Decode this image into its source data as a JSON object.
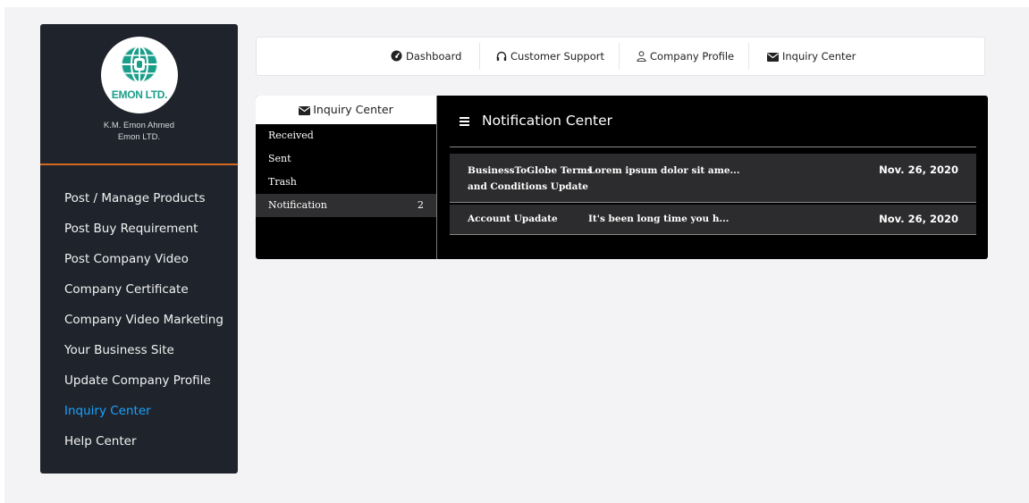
{
  "sidebar": {
    "logo_text": "EMON LTD.",
    "user_name": "K.M. Emon Ahmed",
    "company": "Emon LTD.",
    "accent_color": "#d2691e",
    "items": [
      {
        "label": "Post / Manage Products"
      },
      {
        "label": "Post Buy Requirement"
      },
      {
        "label": "Post Company Video"
      },
      {
        "label": "Company Certificate"
      },
      {
        "label": "Company Video Marketing"
      },
      {
        "label": "Your Business Site"
      },
      {
        "label": "Update Company Profile"
      },
      {
        "label": "Inquiry Center",
        "active": true
      },
      {
        "label": "Help Center"
      }
    ]
  },
  "topnav": {
    "items": [
      {
        "label": "Dashboard",
        "icon": "dashboard-icon"
      },
      {
        "label": "Customer Support",
        "icon": "headphones-icon"
      },
      {
        "label": "Company Profile",
        "icon": "user-icon"
      },
      {
        "label": "Inquiry Center",
        "icon": "envelope-icon"
      }
    ]
  },
  "inquiry": {
    "header": "Inquiry Center",
    "items": [
      {
        "label": "Received"
      },
      {
        "label": "Sent"
      },
      {
        "label": "Trash"
      },
      {
        "label": "Notification",
        "count": "2",
        "active": true
      }
    ]
  },
  "notification_center": {
    "title": "Notification Center",
    "rows": [
      {
        "subject": "BusinessToGlobe Terms and Conditions Update",
        "preview": "Lorem ipsum dolor sit ame...",
        "date": "Nov. 26, 2020"
      },
      {
        "subject": "Account Upadate",
        "preview": "It's been long time you h...",
        "date": "Nov. 26, 2020"
      }
    ]
  },
  "colors": {
    "sidebar_bg": "#1f242c",
    "active_link": "#1aa3ff",
    "logo_green": "#1a9e8a"
  }
}
